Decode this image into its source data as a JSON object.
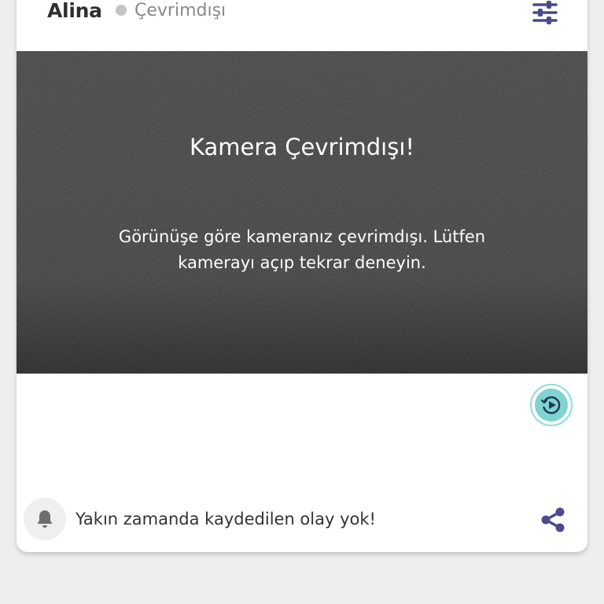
{
  "camera": {
    "name": "Alina",
    "status": "Çevrimdışı"
  },
  "video": {
    "offline_title": "Kamera Çevrimdışı!",
    "offline_message": "Görünüşe göre kameranız çevrimdışı. Lütfen kamerayı açıp tekrar deneyin."
  },
  "events": {
    "message": "Yakın zamanda kaydedilen olay yok!"
  },
  "icons": {
    "settings": "sliders-icon",
    "replay": "replay-icon",
    "bell": "bell-icon",
    "share": "share-icon"
  },
  "colors": {
    "accent": "#4a4a8c",
    "replay_accent": "#7fd3d0",
    "status_dot": "#c4c4c4"
  }
}
